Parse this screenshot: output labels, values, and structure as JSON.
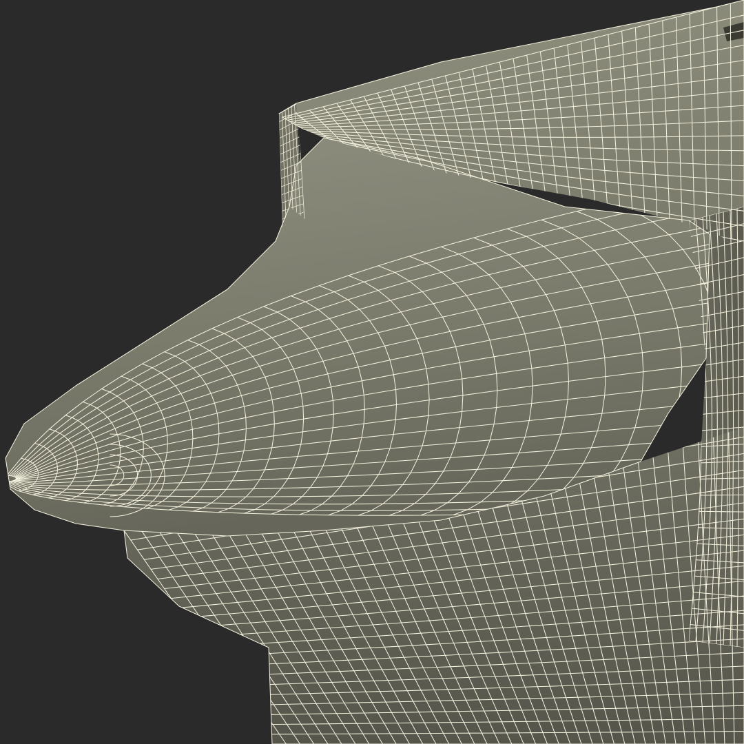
{
  "scene": {
    "subject": "anvil-horn-wireframe",
    "colors": {
      "background": "#2a2a2a",
      "surface_light": "#8c8c7e",
      "surface_mid": "#7a7a6c",
      "surface_dark": "#5e5e52",
      "wireframe": "#f3f0dc"
    }
  }
}
